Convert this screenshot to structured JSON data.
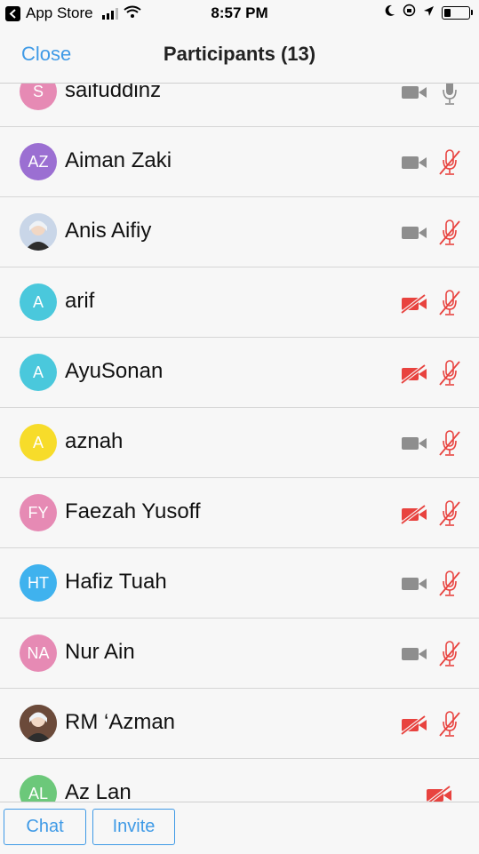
{
  "status_bar": {
    "back_app": "App Store",
    "time": "8:57 PM"
  },
  "nav": {
    "close_label": "Close",
    "title": "Participants (13)"
  },
  "participants": [
    {
      "name": "saifuddinz",
      "initials": "S",
      "avatar_color": "#e68ab4",
      "video": "on",
      "audio": "connected"
    },
    {
      "name": "Aiman Zaki",
      "initials": "AZ",
      "avatar_color": "#9b6fd2",
      "video": "on",
      "audio": "muted"
    },
    {
      "name": "Anis Aifiy",
      "initials": "",
      "avatar_color": "#c9d6e8",
      "avatar_photo": true,
      "video": "on",
      "audio": "muted"
    },
    {
      "name": "arif",
      "initials": "A",
      "avatar_color": "#4ac8dc",
      "video": "off",
      "audio": "muted"
    },
    {
      "name": "AyuSonan",
      "initials": "A",
      "avatar_color": "#4ac8dc",
      "video": "off",
      "audio": "muted"
    },
    {
      "name": "aznah",
      "initials": "A",
      "avatar_color": "#f7dc2a",
      "video": "on",
      "audio": "muted"
    },
    {
      "name": "Faezah Yusoff",
      "initials": "FY",
      "avatar_color": "#e68ab4",
      "video": "off",
      "audio": "muted"
    },
    {
      "name": "Hafiz Tuah",
      "initials": "HT",
      "avatar_color": "#3fb2ee",
      "video": "on",
      "audio": "muted"
    },
    {
      "name": "Nur Ain",
      "initials": "NA",
      "avatar_color": "#e68ab4",
      "video": "on",
      "audio": "muted"
    },
    {
      "name": "RM ‘Azman",
      "initials": "",
      "avatar_color": "#6b4a3a",
      "avatar_photo": true,
      "video": "off",
      "audio": "muted"
    },
    {
      "name": "Az Lan",
      "initials": "AL",
      "avatar_color": "#6cc87a",
      "video": "off",
      "audio": "none"
    }
  ],
  "bottom": {
    "chat_label": "Chat",
    "invite_label": "Invite"
  },
  "colors": {
    "accent": "#3f9ae6",
    "muted_red": "#e8433f",
    "icon_gray": "#8e8e8e"
  }
}
